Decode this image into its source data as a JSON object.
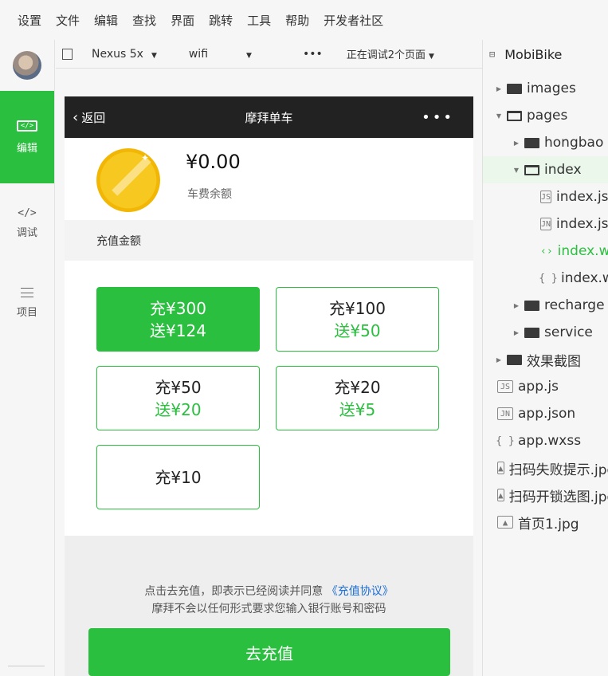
{
  "menu": [
    "设置",
    "文件",
    "编辑",
    "查找",
    "界面",
    "跳转",
    "工具",
    "帮助",
    "开发者社区"
  ],
  "left_toolbar": {
    "edit": {
      "icon": "</>",
      "label": "编辑"
    },
    "debug": {
      "icon": "</>",
      "label": "调试"
    },
    "project": {
      "label": "项目"
    }
  },
  "simulator_bar": {
    "device": "Nexus 5x",
    "network": "wifi",
    "more": "•••",
    "debug_status": "正在调试2个页面"
  },
  "app": {
    "nav": {
      "back_label": "返回",
      "title": "摩拜单车",
      "menu": "•••"
    },
    "balance": {
      "amount": "¥0.00",
      "label": "车费余额"
    },
    "section_title": "充值金额",
    "options": [
      {
        "main": "充¥300",
        "bonus": "送¥124",
        "selected": true
      },
      {
        "main": "充¥100",
        "bonus": "送¥50",
        "selected": false
      },
      {
        "main": "充¥50",
        "bonus": "送¥20",
        "selected": false
      },
      {
        "main": "充¥20",
        "bonus": "送¥5",
        "selected": false
      },
      {
        "main": "充¥10",
        "bonus": "",
        "selected": false
      }
    ],
    "agreement": {
      "prefix": "点击去充值，即表示已经阅读并同意",
      "link": "《充值协议》",
      "line2": "摩拜不会以任何形式要求您输入银行账号和密码"
    },
    "pay_button": "去充值"
  },
  "file_panel": {
    "project_name": "MobiBike",
    "tree": {
      "images": "images",
      "pages": "pages",
      "hongbao": "hongbao",
      "index": "index",
      "index_js": "index.js",
      "index_json": "index.json",
      "index_wxml": "index.wxml",
      "index_wxss": "index.wxss",
      "recharge": "recharge",
      "service": "service",
      "screenshots": "效果截图",
      "app_js": "app.js",
      "app_json": "app.json",
      "app_wxss": "app.wxss",
      "img1": "扫码失败提示.jpg",
      "img2": "扫码开锁选图.jpg",
      "img3": "首页1.jpg"
    }
  },
  "colors": {
    "accent": "#2bbf3f",
    "navbar": "#222222",
    "link": "#1b6dd6"
  }
}
